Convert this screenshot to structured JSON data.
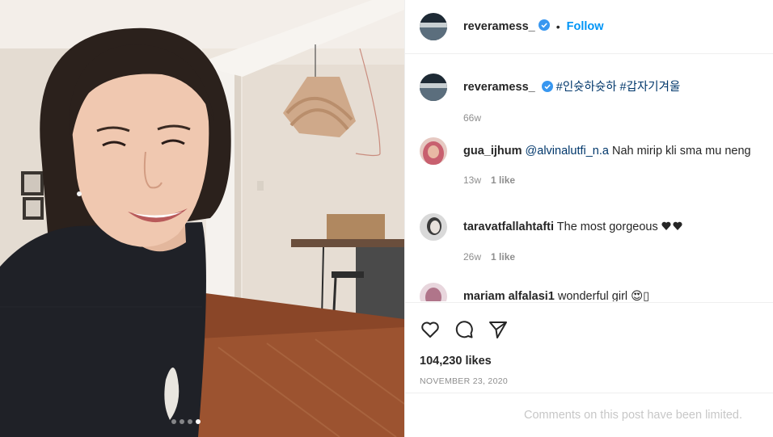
{
  "header": {
    "username": "reveramess_",
    "separator": "•",
    "follow_label": "Follow"
  },
  "caption": {
    "username": "reveramess_",
    "text": "#인슛하슛하 #갑자기겨울",
    "time": "66w"
  },
  "comments": [
    {
      "username": "gua_ijhum",
      "mention": "@alvinalutfi_n.a",
      "text": " Nah mirip kli sma mu neng",
      "time": "13w",
      "likes": "1 like"
    },
    {
      "username": "taravatfallahtafti",
      "mention": "",
      "text": " The most gorgeous ",
      "time": "26w",
      "likes": "1 like"
    },
    {
      "username": "mariam alfalasi1",
      "mention": "",
      "text": " wonderful girl 😍▯",
      "time": "",
      "likes": ""
    }
  ],
  "actions": {
    "likes_count": "104,230 likes",
    "date": "NOVEMBER 23, 2020"
  },
  "footer": {
    "limited_text": "Comments on this post have been limited."
  },
  "colors": {
    "accent": "#0095f6",
    "verified": "#3897f0",
    "muted": "#8e8e8e",
    "border": "#efefef"
  },
  "carousel": {
    "slides": 4,
    "active_index": 3
  }
}
